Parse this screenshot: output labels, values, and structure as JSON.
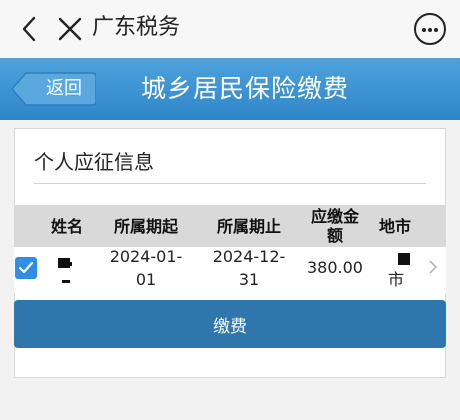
{
  "app_bar": {
    "title": "广东税务"
  },
  "header": {
    "return_label": "返回",
    "title": "城乡居民保险缴费"
  },
  "section": {
    "title": "个人应征信息"
  },
  "table": {
    "columns": [
      "姓名",
      "所属期起",
      "所属期止",
      "应缴金\n额",
      "地市"
    ],
    "rows": [
      {
        "selected": true,
        "name": "",
        "period_start": "2024-01-\n01",
        "period_end": "2024-12-\n31",
        "amount": "380.00",
        "city": "市"
      }
    ]
  },
  "actions": {
    "pay_label": "缴费"
  },
  "colors": {
    "header_blue": "#3b93d4",
    "button_blue": "#2f76ad",
    "checkbox_blue": "#2f8de4",
    "table_head_gray": "#d9d9d9"
  }
}
